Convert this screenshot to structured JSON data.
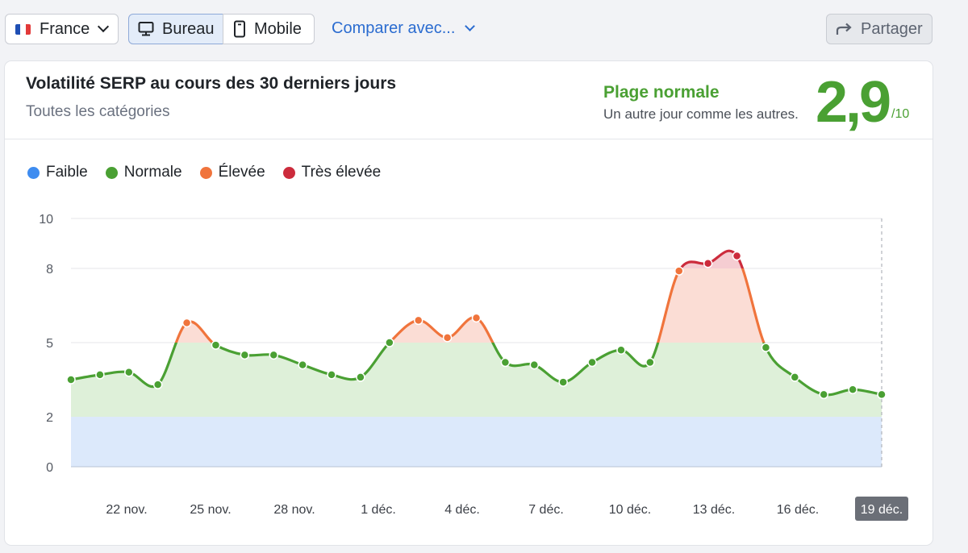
{
  "toolbar": {
    "country": "France",
    "device_desktop": "Bureau",
    "device_mobile": "Mobile",
    "compare": "Comparer avec...",
    "share": "Partager"
  },
  "card": {
    "title": "Volatilité SERP au cours des 30 derniers jours",
    "subtitle": "Toutes les catégories",
    "range_title": "Plage normale",
    "range_sub": "Un autre jour comme les autres.",
    "score": "2,9",
    "score_max": "/10"
  },
  "legend": [
    {
      "label": "Faible",
      "color": "#3e8cf0"
    },
    {
      "label": "Normale",
      "color": "#4aa033"
    },
    {
      "label": "Élevée",
      "color": "#f0743c"
    },
    {
      "label": "Très élevée",
      "color": "#cc2b3c"
    }
  ],
  "colors": {
    "low_band": "#dce9fb",
    "normal_band": "#def0d9",
    "high_band": "#fbddd5",
    "very_high_band": "#f5cdd2",
    "normal_line": "#4aa033",
    "high_line": "#f0743c",
    "very_high_line": "#cc2b3c"
  },
  "chart_data": {
    "type": "line",
    "y_ticks": [
      0,
      2,
      5,
      8,
      10
    ],
    "ylim": [
      0,
      10
    ],
    "thresholds": {
      "low_max": 2,
      "normal_max": 5,
      "high_max": 8
    },
    "x_labels": [
      "22 nov.",
      "25 nov.",
      "28 nov.",
      "1 déc.",
      "4 déc.",
      "7 déc.",
      "10 déc.",
      "13 déc.",
      "16 déc.",
      "19 déc."
    ],
    "highlighted_label": "19 déc.",
    "series": [
      {
        "values": [
          3.5,
          3.7,
          3.8,
          3.3,
          5.8,
          4.9,
          4.5,
          4.5,
          4.1,
          3.7,
          3.6,
          5.0,
          5.9,
          5.2,
          6.0,
          4.2,
          4.1,
          3.4,
          4.2,
          4.7,
          4.2,
          7.9,
          8.2,
          8.5,
          4.8,
          3.6,
          2.9,
          3.1,
          2.9
        ]
      }
    ]
  }
}
